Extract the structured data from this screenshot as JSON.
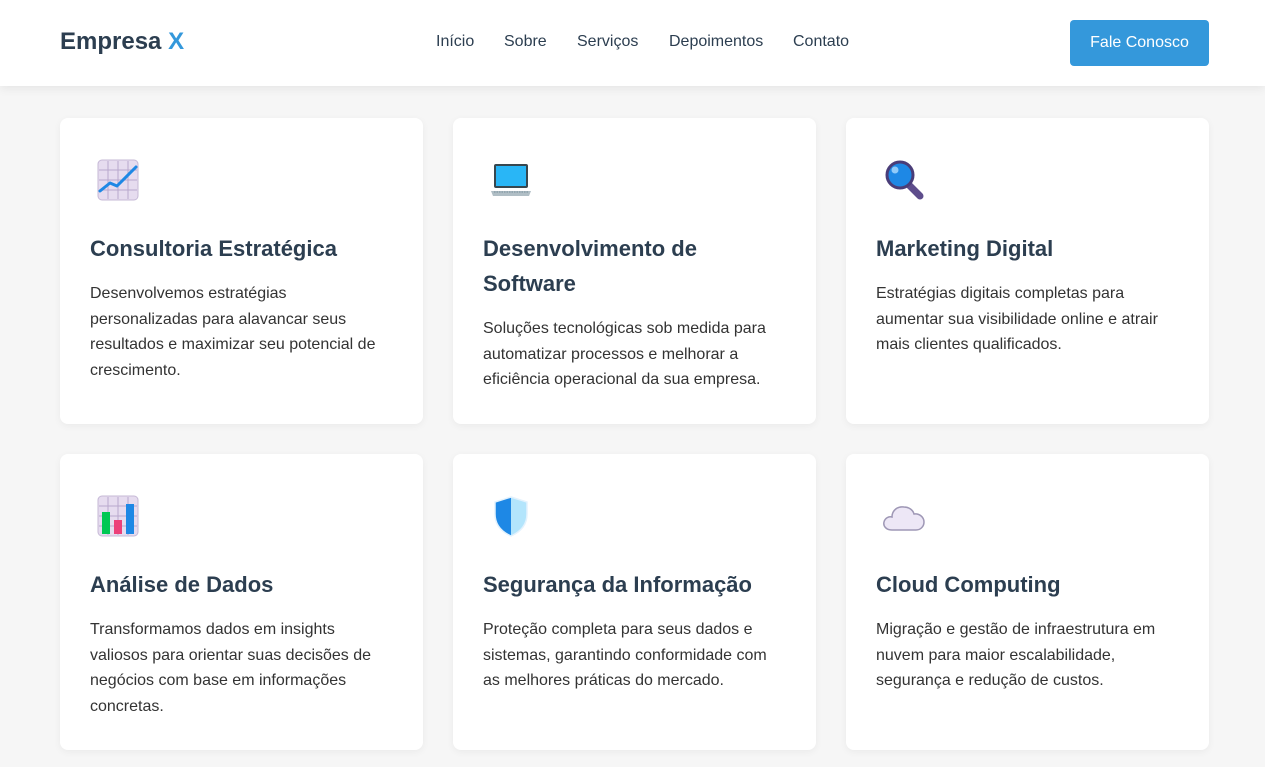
{
  "header": {
    "logo_text": "Empresa",
    "logo_accent": "X",
    "nav": [
      "Início",
      "Sobre",
      "Serviços",
      "Depoimentos",
      "Contato"
    ],
    "cta_label": "Fale Conosco"
  },
  "colors": {
    "accent": "#3498db",
    "heading": "#2c3e50",
    "background": "#f6f6f6"
  },
  "services": [
    {
      "icon": "chart-increasing-icon",
      "title": "Consultoria Estratégica",
      "description": "Desenvolvemos estratégias personalizadas para alavancar seus resultados e maximizar seu potencial de crescimento."
    },
    {
      "icon": "laptop-icon",
      "title": "Desenvolvimento de Software",
      "description": "Soluções tecnológicas sob medida para automatizar processos e melhorar a eficiência operacional da sua empresa."
    },
    {
      "icon": "magnifying-glass-icon",
      "title": "Marketing Digital",
      "description": "Estratégias digitais completas para aumentar sua visibilidade online e atrair mais clientes qualificados."
    },
    {
      "icon": "bar-chart-icon",
      "title": "Análise de Dados",
      "description": "Transformamos dados em insights valiosos para orientar suas decisões de negócios com base em informações concretas."
    },
    {
      "icon": "shield-icon",
      "title": "Segurança da Informação",
      "description": "Proteção completa para seus dados e sistemas, garantindo conformidade com as melhores práticas do mercado."
    },
    {
      "icon": "cloud-icon",
      "title": "Cloud Computing",
      "description": "Migração e gestão de infraestrutura em nuvem para maior escalabilidade, segurança e redução de custos."
    }
  ]
}
